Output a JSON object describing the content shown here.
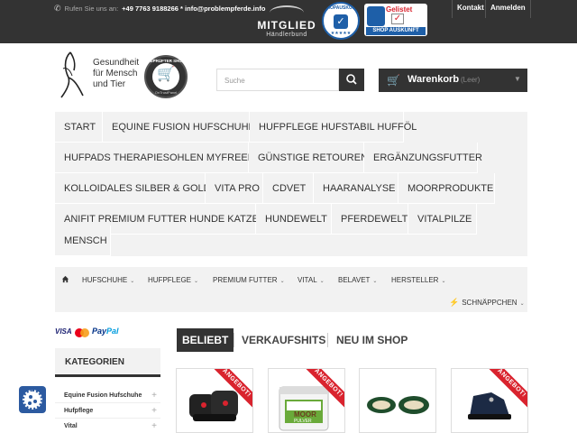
{
  "topbar": {
    "contact_prefix": "Rufen Sie uns an:",
    "contact_info": "+49 7763 9188266 * info@problempferde.info",
    "mitglied_title": "MITGLIED",
    "mitglied_sub": "Händlerbund",
    "shopauskunft_ring": "SHOPAUSKUNFT.DE",
    "gelistet": "Gelistet",
    "shop_auskunft": "SHOP AUSKUNFT",
    "kontakt": "Kontakt",
    "anmelden": "Anmelden"
  },
  "header": {
    "claim_line1": "Gesundheit",
    "claim_line2": "für Mensch",
    "claim_line3": "und Tier",
    "badge_top": "GEPRÜFTER SHOP",
    "badge_bottom": "OnTrustPanel",
    "search_placeholder": "Suche",
    "cart_label": "Warenkorb",
    "cart_status": "(Leer)"
  },
  "categories": [
    "Start",
    "Equine Fusion Hufschuhe",
    "Hufpflege Hufstabil Hufföl",
    "Hufpads Therapiesohlen MyFreedm",
    "Günstige Retouren",
    "Ergänzungsfutter",
    "Kolloidales Silber & Gold",
    "Vita Pro",
    "CDVet",
    "Haaranalyse",
    "Moorprodukte",
    "Anifit Premium Futter Hunde Katzen",
    "Hundewelt",
    "Pferdewelt",
    "Vitalpilze",
    "Mensch"
  ],
  "subnav": {
    "home_icon": "home-icon",
    "items": [
      "HUFSCHUHE",
      "HUFPFLEGE",
      "PREMIUM FUTTER",
      "VITAL",
      "BELAVET",
      "HERSTELLER",
      "SCHNÄPPCHEN"
    ]
  },
  "payments": {
    "visa": "VISA",
    "paypal_a": "Pay",
    "paypal_b": "Pal"
  },
  "sidebar": {
    "title": "KATEGORIEN",
    "items": [
      "Equine Fusion Hufschuhe",
      "Hufpflege",
      "Vital"
    ]
  },
  "tabs": [
    "BELIEBT",
    "VERKAUFSHITS",
    "NEU IM SHOP"
  ],
  "products": [
    {
      "ribbon": "ANGEBOT!",
      "image": "hoof-boots"
    },
    {
      "ribbon": "ANGEBOT!",
      "image": "moor-pulver-bucket",
      "brand": "MOOR",
      "sub": "PULVER"
    },
    {
      "ribbon": "",
      "image": "dog-beds"
    },
    {
      "ribbon": "ANGEBOT!",
      "image": "hoof-boot-blue"
    }
  ],
  "colors": {
    "dark": "#333333",
    "menu_bg": "#f2f2f2",
    "offer_red": "#d9232e",
    "badge_blue": "#1e5fa8"
  }
}
